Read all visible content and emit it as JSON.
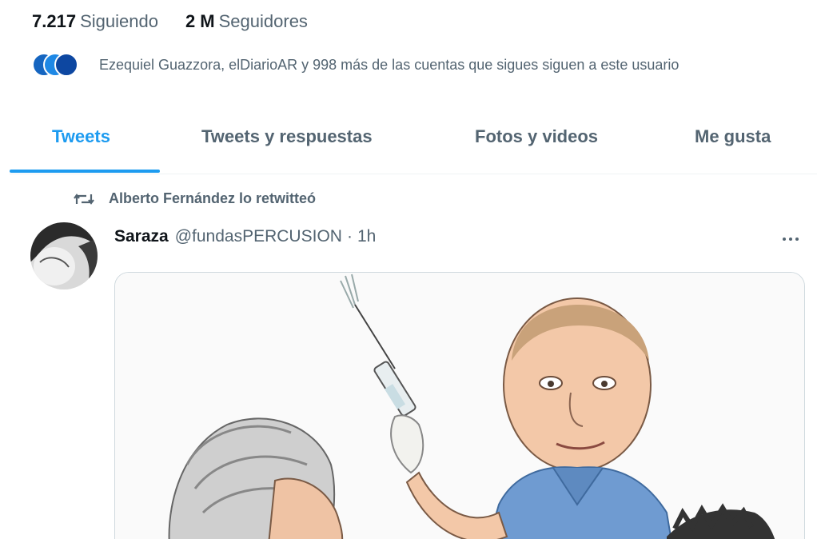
{
  "profile_stats": {
    "following_count": "7.217",
    "following_label": "Siguiendo",
    "followers_count": "2 M",
    "followers_label": "Seguidores"
  },
  "followed_by": {
    "text": "Ezequiel Guazzora, elDiarioAR y 998 más de las cuentas que sigues siguen a este usuario",
    "avatar_colors": [
      "#1565c0",
      "#1e88e5",
      "#0d47a1"
    ]
  },
  "tabs": [
    {
      "label": "Tweets",
      "active": true
    },
    {
      "label": "Tweets y respuestas",
      "active": false
    },
    {
      "label": "Fotos y videos",
      "active": false
    },
    {
      "label": "Me gusta",
      "active": false
    }
  ],
  "tweet": {
    "retweet_text": "Alberto Fernández lo retwitteó",
    "retweet_icon": "retweet-icon",
    "author_name": "Saraza",
    "author_handle": "@fundasPERCUSION",
    "separator": "·",
    "time": "1h",
    "more_icon": "more-dots-icon",
    "media_description_icon": "caricature-image"
  },
  "colors": {
    "accent": "#1d9bf0",
    "text_primary": "#0f1419",
    "text_secondary": "#536471",
    "border": "#eff3f4"
  }
}
